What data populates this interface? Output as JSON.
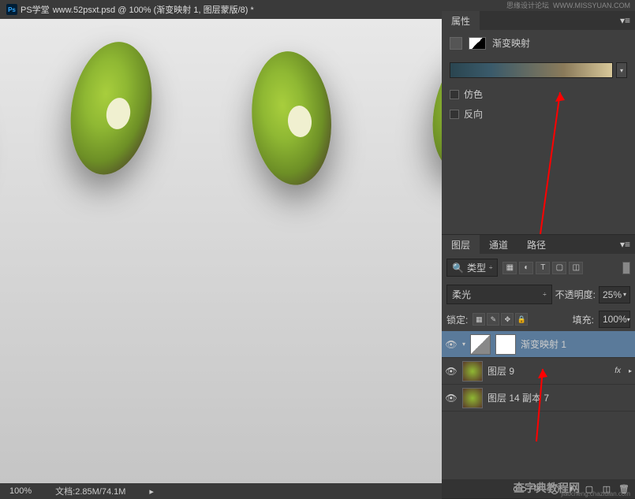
{
  "tab": {
    "prefix": "PS学堂",
    "filename": "www.52psxt.psd @ 100% (渐变映射 1, 图层蒙版/8) *"
  },
  "statusbar": {
    "zoom": "100%",
    "docinfo": "文档:2.85M/74.1M"
  },
  "watermarks": {
    "forum": "思缘设计论坛",
    "site": "WWW.MISSYUAN.COM",
    "brand": "查字典教程网",
    "brand_url": "jiaocheng.chazidian.com"
  },
  "properties": {
    "tab_label": "属性",
    "adjustment_name": "渐变映射",
    "dither_label": "仿色",
    "reverse_label": "反向"
  },
  "layers": {
    "tab_layers": "图层",
    "tab_channels": "通道",
    "tab_paths": "路径",
    "filter_label": "类型",
    "blend_mode": "柔光",
    "opacity_label": "不透明度:",
    "opacity_value": "25%",
    "lock_label": "锁定:",
    "fill_label": "填充:",
    "fill_value": "100%",
    "items": [
      {
        "name": "渐变映射 1",
        "selected": true,
        "thumb": "grad",
        "mask": true
      },
      {
        "name": "图层 9",
        "selected": false,
        "thumb": "kiwi",
        "fx": "fx"
      },
      {
        "name": "图层 14 副本 7",
        "selected": false,
        "thumb": "kiwi"
      }
    ]
  },
  "icons": {
    "dropdown": "▾",
    "chevrons": "▸",
    "eye": "👁",
    "search": "🔍"
  }
}
